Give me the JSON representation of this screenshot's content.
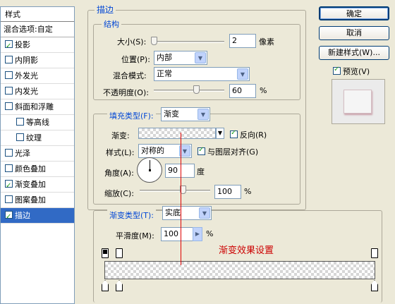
{
  "style_panel": {
    "header": "样式",
    "blend_options": "混合选项:自定",
    "items": [
      {
        "label": "投影",
        "checked": true,
        "sub": false,
        "selected": false
      },
      {
        "label": "内阴影",
        "checked": false,
        "sub": false,
        "selected": false
      },
      {
        "label": "外发光",
        "checked": false,
        "sub": false,
        "selected": false
      },
      {
        "label": "内发光",
        "checked": false,
        "sub": false,
        "selected": false
      },
      {
        "label": "斜面和浮雕",
        "checked": false,
        "sub": false,
        "selected": false
      },
      {
        "label": "等高线",
        "checked": false,
        "sub": true,
        "selected": false
      },
      {
        "label": "纹理",
        "checked": false,
        "sub": true,
        "selected": false
      },
      {
        "label": "光泽",
        "checked": false,
        "sub": false,
        "selected": false
      },
      {
        "label": "颜色叠加",
        "checked": false,
        "sub": false,
        "selected": false
      },
      {
        "label": "渐变叠加",
        "checked": true,
        "sub": false,
        "selected": false
      },
      {
        "label": "图案叠加",
        "checked": false,
        "sub": false,
        "selected": false
      },
      {
        "label": "描边",
        "checked": true,
        "sub": false,
        "selected": true
      }
    ]
  },
  "stroke": {
    "title": "描边",
    "structure": {
      "title": "结构",
      "size_label": "大小(S):",
      "size_value": "2",
      "size_unit": "像素",
      "size_fraction": 0.02,
      "position_label": "位置(P):",
      "position_value": "内部",
      "blend_mode_label": "混合模式:",
      "blend_mode_value": "正常",
      "opacity_label": "不透明度(O):",
      "opacity_value": "60",
      "opacity_unit": "%",
      "opacity_fraction": 0.6
    },
    "fill": {
      "fill_type_label": "填充类型(F):",
      "fill_type_value": "渐变",
      "gradient_label": "渐变:",
      "reverse_label": "反向(R)",
      "reverse_checked": true,
      "style_label": "样式(L):",
      "style_value": "对称的",
      "align_label": "与图层对齐(G)",
      "align_checked": true,
      "angle_label": "角度(A):",
      "angle_value": "90",
      "angle_unit": "度",
      "scale_label": "缩放(C):",
      "scale_value": "100",
      "scale_unit": "%",
      "scale_fraction": 0.5
    }
  },
  "gradient_editor": {
    "gradient_type_label": "渐变类型(T):",
    "gradient_type_value": "实底",
    "smoothness_label": "平滑度(M):",
    "smoothness_value": "100",
    "smoothness_unit": "%",
    "annotation": "渐变效果设置"
  },
  "buttons": {
    "ok": "确定",
    "cancel": "取消",
    "new_style": "新建样式(W)...",
    "preview_label": "预览(V)",
    "preview_checked": true
  },
  "colors": {
    "accent": "#0046d5",
    "selection": "#316ac5",
    "annotation": "#cc0000",
    "check": "#21a121"
  }
}
